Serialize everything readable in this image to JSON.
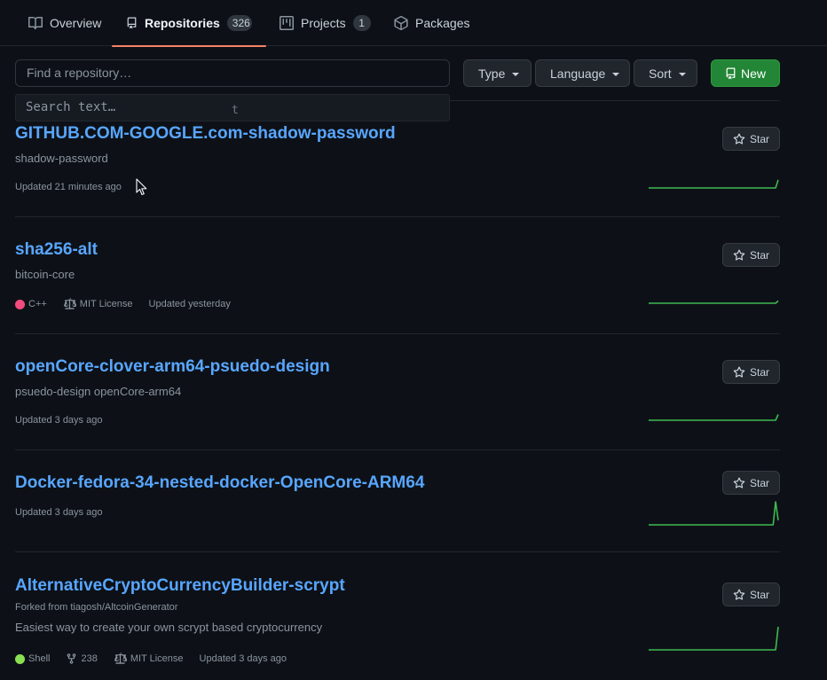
{
  "tabs": [
    {
      "label": "Overview"
    },
    {
      "label": "Repositories",
      "count": "326"
    },
    {
      "label": "Projects",
      "count": "1"
    },
    {
      "label": "Packages"
    }
  ],
  "filters": {
    "find_placeholder": "Find a repository…",
    "search_text_placeholder": "Search text…",
    "stray_char": "t",
    "type_label": "Type",
    "language_label": "Language",
    "sort_label": "Sort",
    "new_label": "New"
  },
  "star_label": "Star",
  "colors": {
    "accent_link": "#58a6ff",
    "new_button": "#238636",
    "tab_underline": "#f78166",
    "sparkline": "#3fb950"
  },
  "repos": [
    {
      "name": "GITHUB.COM-GOOGLE.com-shadow-password",
      "description": "shadow-password",
      "updated": "Updated 21 minutes ago",
      "spark": [
        0,
        0,
        0,
        0,
        0,
        0,
        0,
        0,
        0,
        0,
        0,
        0,
        0,
        0,
        0,
        0,
        0,
        0,
        0,
        0,
        0,
        0,
        0,
        0,
        0,
        0,
        0,
        0,
        0,
        0,
        0,
        0,
        0,
        0,
        0,
        0,
        0,
        0,
        0,
        0.0,
        0.0,
        0.0,
        0,
        0,
        0,
        0,
        0,
        0,
        0,
        0,
        0,
        0.35
      ]
    },
    {
      "name": "sha256-alt",
      "description": "bitcoin-core",
      "language": "C++",
      "language_color": "#f34b7d",
      "license": "MIT License",
      "updated": "Updated yesterday",
      "spark": [
        0,
        0,
        0,
        0,
        0,
        0,
        0,
        0,
        0,
        0,
        0,
        0,
        0,
        0,
        0,
        0,
        0,
        0,
        0,
        0,
        0,
        0,
        0,
        0,
        0,
        0,
        0,
        0,
        0,
        0,
        0,
        0,
        0,
        0,
        0,
        0,
        0,
        0,
        0,
        0,
        0,
        0,
        0,
        0,
        0,
        0,
        0,
        0,
        0,
        0,
        0,
        0.1
      ]
    },
    {
      "name": "openCore-clover-arm64-psuedo-design",
      "description": "psuedo-design openCore-arm64",
      "updated": "Updated 3 days ago",
      "spark": [
        0,
        0,
        0,
        0,
        0,
        0,
        0,
        0,
        0,
        0,
        0,
        0,
        0,
        0,
        0,
        0,
        0,
        0,
        0,
        0,
        0,
        0,
        0,
        0,
        0,
        0,
        0,
        0,
        0,
        0,
        0,
        0,
        0,
        0,
        0,
        0,
        0,
        0,
        0,
        0,
        0,
        0,
        0,
        0,
        0,
        0,
        0,
        0,
        0,
        0,
        0,
        0.25
      ]
    },
    {
      "name": "Docker-fedora-34-nested-docker-OpenCore-ARM64",
      "updated": "Updated 3 days ago",
      "spark": [
        0,
        0,
        0,
        0,
        0,
        0,
        0,
        0,
        0,
        0,
        0,
        0,
        0,
        0,
        0,
        0,
        0,
        0,
        0,
        0,
        0,
        0,
        0,
        0,
        0,
        0,
        0,
        0,
        0,
        0,
        0,
        0,
        0,
        0,
        0,
        0,
        0,
        0,
        0,
        0,
        0,
        0,
        0,
        0,
        0,
        0,
        0,
        0,
        0,
        0,
        1,
        0.2
      ]
    },
    {
      "name": "AlternativeCryptoCurrencyBuilder-scrypt",
      "fork_note": "Forked from tiagosh/AltcoinGenerator",
      "description": "Easiest way to create your own scrypt based cryptocurrency",
      "language": "Shell",
      "language_color": "#89e051",
      "forks": "238",
      "license": "MIT License",
      "updated": "Updated 3 days ago",
      "spark": [
        0,
        0,
        0,
        0,
        0,
        0,
        0,
        0,
        0,
        0,
        0,
        0,
        0,
        0,
        0,
        0,
        0,
        0,
        0,
        0,
        0,
        0,
        0,
        0,
        0,
        0,
        0,
        0,
        0,
        0,
        0,
        0,
        0,
        0,
        0,
        0,
        0,
        0,
        0,
        0,
        0,
        0,
        0,
        0,
        0,
        0,
        0,
        0,
        0,
        0,
        0,
        1
      ]
    }
  ]
}
